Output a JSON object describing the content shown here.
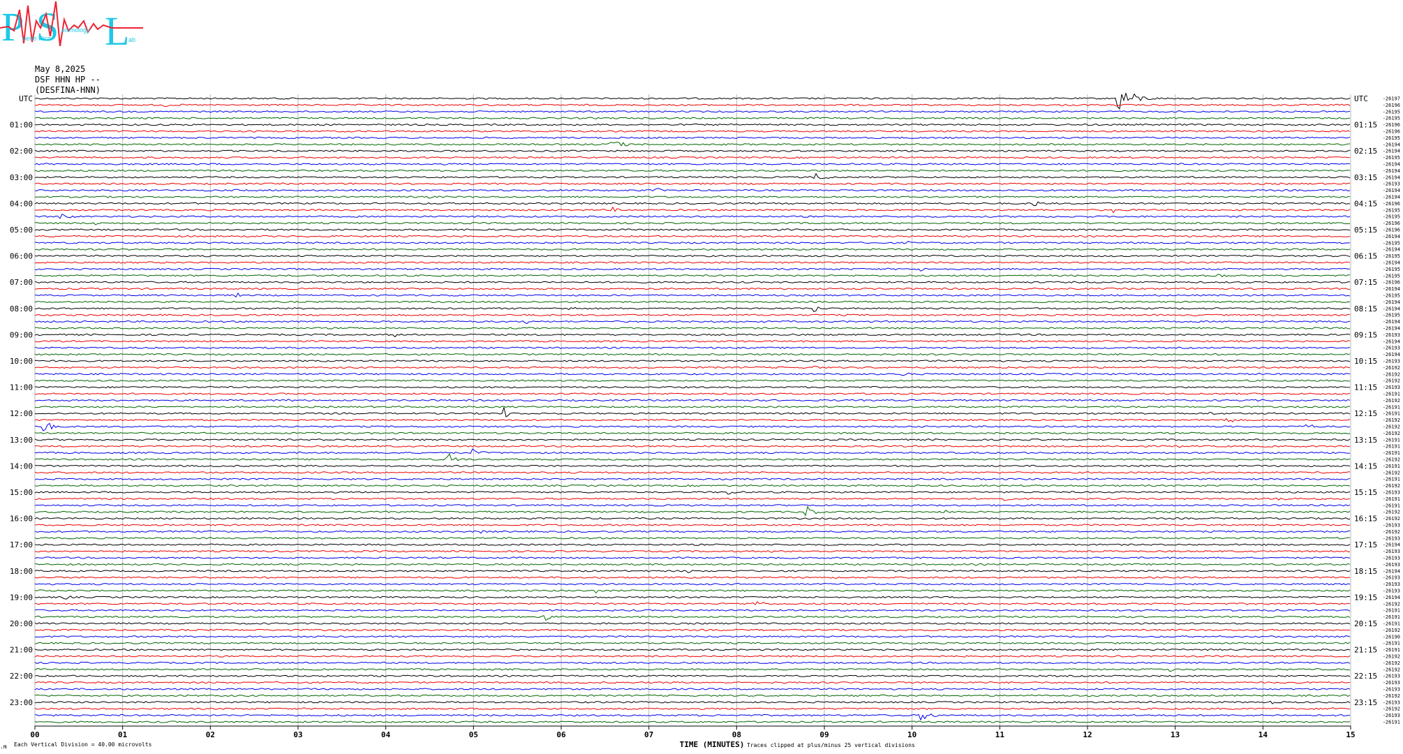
{
  "logo": {
    "initials": [
      "P",
      "S",
      "L"
    ],
    "small_text": [
      "uerto Rico",
      "eismology",
      "ab"
    ],
    "colors": {
      "letters": "#1ec8e6",
      "trace": "#ee2233"
    }
  },
  "header": {
    "date": "May 8,2025",
    "station": "DSF HHN HP --",
    "network": "(DESFINA-HNN)"
  },
  "chart_data": {
    "type": "seismogram (helicorder)",
    "title": "",
    "left_axis_label": "UTC",
    "right_axis_label": "UTC",
    "xlabel": "TIME (MINUTES)",
    "x_ticks": [
      "00",
      "01",
      "02",
      "03",
      "04",
      "05",
      "06",
      "07",
      "08",
      "09",
      "10",
      "11",
      "12",
      "13",
      "14",
      "15"
    ],
    "xlim": [
      0,
      15
    ],
    "rows_per_hour": 4,
    "row_minutes": 15,
    "num_rows": 96,
    "trace_colors": [
      "#000000",
      "#ee0000",
      "#0000ee",
      "#006600"
    ],
    "hour_labels_left": [
      "UTC",
      "01:00",
      "02:00",
      "03:00",
      "04:00",
      "05:00",
      "06:00",
      "07:00",
      "08:00",
      "09:00",
      "10:00",
      "11:00",
      "12:00",
      "13:00",
      "14:00",
      "15:00",
      "16:00",
      "17:00",
      "18:00",
      "19:00",
      "20:00",
      "21:00",
      "22:00",
      "23:00"
    ],
    "hour_labels_right": [
      "UTC",
      "01:15",
      "02:15",
      "03:15",
      "04:15",
      "05:15",
      "06:15",
      "07:15",
      "08:15",
      "09:15",
      "10:15",
      "11:15",
      "12:15",
      "13:15",
      "14:15",
      "15:15",
      "16:15",
      "17:15",
      "18:15",
      "19:15",
      "20:15",
      "21:15",
      "22:15",
      "23:15"
    ],
    "row_offsets": [
      -26197,
      -26196,
      -26195,
      -26195,
      -26196,
      -26196,
      -26195,
      -26194,
      -26194,
      -26195,
      -26194,
      -26194,
      -26194,
      -26193,
      -26194,
      -26194,
      -26196,
      -26195,
      -26195,
      -26196,
      -26196,
      -26194,
      -26195,
      -26194,
      -26195,
      -26194,
      -26195,
      -26195,
      -26196,
      -26194,
      -26195,
      -26194,
      -26194,
      -26195,
      -26194,
      -26194,
      -26193,
      -26194,
      -26193,
      -26194,
      -26193,
      -26192,
      -26192,
      -26192,
      -26193,
      -26191,
      -26192,
      -26191,
      -26191,
      -26192,
      -26192,
      -26192,
      -26191,
      -26191,
      -26191,
      -26192,
      -26191,
      -26192,
      -26191,
      -26192,
      -26193,
      -26191,
      -26191,
      -26192,
      -26192,
      -26193,
      -26192,
      -26193,
      -26194,
      -26193,
      -26193,
      -26193,
      -26194,
      -26193,
      -26193,
      -26193,
      -26194,
      -26192,
      -26191,
      -26191,
      -26191,
      -26192,
      -26190,
      -26191,
      -26191,
      -26192,
      -26192,
      -26192,
      -26193,
      -26193,
      -26193,
      -26192,
      -26193,
      -26192,
      -26193,
      -26191
    ],
    "events": [
      {
        "row": 0,
        "minute": 12.35,
        "duration_min": 0.5,
        "amplitude": 20
      },
      {
        "row": 1,
        "minute": 1.5,
        "duration_min": 0.15,
        "amplitude": 3
      },
      {
        "row": 7,
        "minute": 6.5,
        "duration_min": 0.7,
        "amplitude": 7
      },
      {
        "row": 12,
        "minute": 8.9,
        "duration_min": 0.4,
        "amplitude": 6
      },
      {
        "row": 14,
        "minute": 7.1,
        "duration_min": 0.2,
        "amplitude": 4
      },
      {
        "row": 14,
        "minute": 2.3,
        "duration_min": 0.1,
        "amplitude": 3
      },
      {
        "row": 15,
        "minute": 4.5,
        "duration_min": 0.1,
        "amplitude": 4
      },
      {
        "row": 16,
        "minute": 11.4,
        "duration_min": 0.2,
        "amplitude": 6
      },
      {
        "row": 17,
        "minute": 6.6,
        "duration_min": 0.15,
        "amplitude": 4
      },
      {
        "row": 17,
        "minute": 12.3,
        "duration_min": 0.1,
        "amplitude": 4
      },
      {
        "row": 18,
        "minute": 0.3,
        "duration_min": 0.3,
        "amplitude": 6
      },
      {
        "row": 18,
        "minute": 12.5,
        "duration_min": 0.2,
        "amplitude": 4
      },
      {
        "row": 19,
        "minute": 0.7,
        "duration_min": 0.2,
        "amplitude": 3
      },
      {
        "row": 22,
        "minute": 9.95,
        "duration_min": 0.1,
        "amplitude": 4
      },
      {
        "row": 23,
        "minute": 4.3,
        "duration_min": 0.2,
        "amplitude": 4
      },
      {
        "row": 26,
        "minute": 10.1,
        "duration_min": 0.1,
        "amplitude": 5
      },
      {
        "row": 27,
        "minute": 13.5,
        "duration_min": 0.3,
        "amplitude": 4
      },
      {
        "row": 30,
        "minute": 2.3,
        "duration_min": 0.2,
        "amplitude": 4
      },
      {
        "row": 32,
        "minute": 6.1,
        "duration_min": 0.2,
        "amplitude": 4
      },
      {
        "row": 32,
        "minute": 8.9,
        "duration_min": 0.1,
        "amplitude": 6
      },
      {
        "row": 34,
        "minute": 5.6,
        "duration_min": 0.15,
        "amplitude": 4
      },
      {
        "row": 36,
        "minute": 4.1,
        "duration_min": 0.1,
        "amplitude": 4
      },
      {
        "row": 41,
        "minute": 8.9,
        "duration_min": 0.2,
        "amplitude": 3
      },
      {
        "row": 42,
        "minute": 9.9,
        "duration_min": 0.3,
        "amplitude": 3
      },
      {
        "row": 46,
        "minute": 2.9,
        "duration_min": 0.1,
        "amplitude": 4
      },
      {
        "row": 48,
        "minute": 5.35,
        "duration_min": 0.15,
        "amplitude": 9
      },
      {
        "row": 48,
        "minute": 13.4,
        "duration_min": 0.2,
        "amplitude": 3
      },
      {
        "row": 49,
        "minute": 13.6,
        "duration_min": 0.3,
        "amplitude": 5
      },
      {
        "row": 50,
        "minute": 0.1,
        "duration_min": 0.25,
        "amplitude": 11
      },
      {
        "row": 50,
        "minute": 14.5,
        "duration_min": 0.2,
        "amplitude": 7
      },
      {
        "row": 53,
        "minute": 13.0,
        "duration_min": 0.3,
        "amplitude": 3
      },
      {
        "row": 54,
        "minute": 5.0,
        "duration_min": 0.3,
        "amplitude": 6
      },
      {
        "row": 55,
        "minute": 4.7,
        "duration_min": 0.3,
        "amplitude": 12
      },
      {
        "row": 60,
        "minute": 7.9,
        "duration_min": 0.4,
        "amplitude": 4
      },
      {
        "row": 61,
        "minute": 11.05,
        "duration_min": 0.1,
        "amplitude": 6
      },
      {
        "row": 61,
        "minute": 14.2,
        "duration_min": 0.3,
        "amplitude": 4
      },
      {
        "row": 63,
        "minute": 8.8,
        "duration_min": 0.2,
        "amplitude": 12
      },
      {
        "row": 63,
        "minute": 10.4,
        "duration_min": 0.2,
        "amplitude": 3
      },
      {
        "row": 66,
        "minute": 5.1,
        "duration_min": 0.15,
        "amplitude": 3
      },
      {
        "row": 69,
        "minute": 8.4,
        "duration_min": 0.1,
        "amplitude": 3
      },
      {
        "row": 72,
        "minute": 7.45,
        "duration_min": 0.1,
        "amplitude": 4
      },
      {
        "row": 76,
        "minute": 0.35,
        "duration_min": 0.2,
        "amplitude": 4
      },
      {
        "row": 75,
        "minute": 6.4,
        "duration_min": 0.1,
        "amplitude": 4
      },
      {
        "row": 77,
        "minute": 8.2,
        "duration_min": 0.3,
        "amplitude": 8
      },
      {
        "row": 79,
        "minute": 5.8,
        "duration_min": 0.2,
        "amplitude": 8
      },
      {
        "row": 87,
        "minute": 12.95,
        "duration_min": 0.1,
        "amplitude": 4
      },
      {
        "row": 92,
        "minute": 12.9,
        "duration_min": 0.1,
        "amplitude": 3
      },
      {
        "row": 92,
        "minute": 14.1,
        "duration_min": 0.1,
        "amplitude": 3
      },
      {
        "row": 93,
        "minute": 14.8,
        "duration_min": 0.1,
        "amplitude": 5
      },
      {
        "row": 94,
        "minute": 10.1,
        "duration_min": 0.35,
        "amplitude": 9
      }
    ]
  },
  "footer": {
    "vertical_division": "Each Vertical Division =   40.00 microvolts",
    "clip_note": "Traces clipped at plus/minus 25 vertical divisions",
    "corner_mark": ".m"
  }
}
